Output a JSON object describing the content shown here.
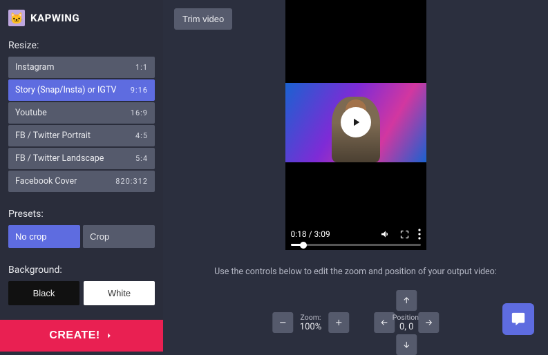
{
  "brand": {
    "name": "KAPWING",
    "logo_glyph": "🐱"
  },
  "sidebar": {
    "resize_label": "Resize:",
    "resize_options": [
      {
        "label": "Instagram",
        "ratio": "1:1",
        "active": false
      },
      {
        "label": "Story (Snap/Insta) or IGTV",
        "ratio": "9:16",
        "active": true
      },
      {
        "label": "Youtube",
        "ratio": "16:9",
        "active": false
      },
      {
        "label": "FB / Twitter Portrait",
        "ratio": "4:5",
        "active": false
      },
      {
        "label": "FB / Twitter Landscape",
        "ratio": "5:4",
        "active": false
      },
      {
        "label": "Facebook Cover",
        "ratio": "820:312",
        "active": false
      }
    ],
    "presets_label": "Presets:",
    "presets": [
      {
        "label": "No crop",
        "active": true
      },
      {
        "label": "Crop",
        "active": false
      }
    ],
    "background_label": "Background:",
    "bg_options": {
      "black": "Black",
      "white": "White"
    },
    "create_label": "CREATE!"
  },
  "main": {
    "trim_label": "Trim video",
    "video": {
      "current_time": "0:18",
      "duration": "3:09",
      "time_text": "0:18 / 3:09"
    },
    "hint": "Use the controls below to edit the zoom and position of your output video:",
    "zoom": {
      "label": "Zoom:",
      "value": "100%"
    },
    "position": {
      "label": "Position:",
      "value": "0, 0"
    }
  },
  "colors": {
    "accent": "#5e6ce0",
    "primary_action": "#e92052",
    "panel": "#555a6c",
    "bg": "#2b2f3e"
  }
}
